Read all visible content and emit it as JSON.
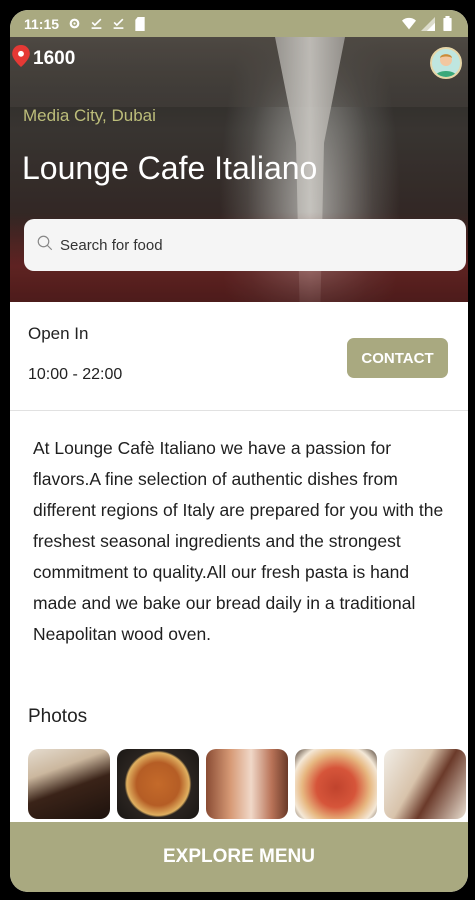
{
  "status_bar": {
    "time": "11:15",
    "icons": [
      "settings-icon",
      "download-done-icon",
      "download-done-icon",
      "sd-card-icon",
      "wifi-icon",
      "signal-icon",
      "battery-icon"
    ]
  },
  "header": {
    "points": "1600",
    "location": "Media City, Dubai",
    "restaurant_name": "Lounge Cafe Italiano"
  },
  "search": {
    "placeholder": "Search for food"
  },
  "hours": {
    "label": "Open In",
    "value": "10:00 - 22:00",
    "contact_label": "CONTACT"
  },
  "description": "At Lounge Cafè Italiano we have a passion for flavors.A fine selection of authentic dishes from different regions of Italy are prepared for you with the freshest seasonal ingredients and the strongest commitment to quality.All our fresh pasta is hand made and we bake our bread daily in a traditional Neapolitan wood oven.",
  "photos": {
    "title": "Photos",
    "items": [
      "dessert-photo",
      "pizza-photo",
      "drinks-photo",
      "pizza-photo",
      "wrap-photo"
    ]
  },
  "footer": {
    "explore_label": "EXPLORE MENU"
  },
  "colors": {
    "accent": "#a9a980",
    "location_text": "#bcbd7a"
  }
}
